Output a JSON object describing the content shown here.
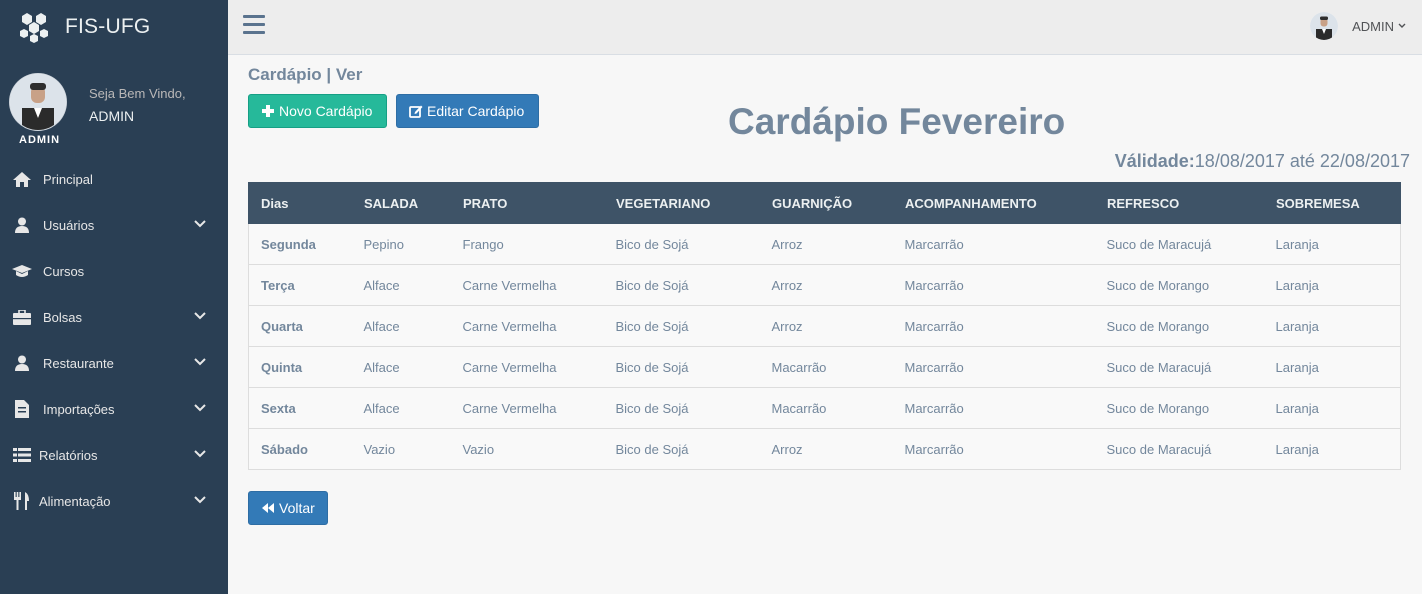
{
  "app": {
    "title": "FIS-UFG"
  },
  "sidebar": {
    "welcome": "Seja Bem Vindo,",
    "user_name": "ADMIN",
    "avatar_tag": "ADMIN",
    "items": [
      {
        "label": "Principal",
        "icon": "home-icon",
        "has_submenu": false
      },
      {
        "label": "Usuários",
        "icon": "user-icon",
        "has_submenu": true
      },
      {
        "label": "Cursos",
        "icon": "graduation-cap-icon",
        "has_submenu": false
      },
      {
        "label": "Bolsas",
        "icon": "briefcase-icon",
        "has_submenu": true
      },
      {
        "label": "Restaurante",
        "icon": "user-icon",
        "has_submenu": true
      },
      {
        "label": "Importações",
        "icon": "file-icon",
        "has_submenu": true
      },
      {
        "label": "Relatórios",
        "icon": "list-icon",
        "has_submenu": true
      },
      {
        "label": "Alimentação",
        "icon": "cutlery-icon",
        "has_submenu": true
      }
    ]
  },
  "topnav": {
    "user_label": "ADMIN"
  },
  "page": {
    "title": "Cardápio | Ver",
    "new_button": "Novo Cardápio",
    "edit_button": "Editar Cardápio",
    "heading": "Cardápio Fevereiro",
    "validity_label": "Válidade:",
    "validity_value": "18/08/2017 até 22/08/2017",
    "back_button": "Voltar"
  },
  "table": {
    "headers": [
      "Dias",
      "SALADA",
      "PRATO",
      "VEGETARIANO",
      "GUARNIÇÃO",
      "ACOMPANHAMENTO",
      "REFRESCO",
      "SOBREMESA"
    ],
    "rows": [
      [
        "Segunda",
        "Pepino",
        "Frango",
        "Bico de Sojá",
        "Arroz",
        "Marcarrão",
        "Suco de Maracujá",
        "Laranja"
      ],
      [
        "Terça",
        "Alface",
        "Carne Vermelha",
        "Bico de Sojá",
        "Arroz",
        "Marcarrão",
        "Suco de Morango",
        "Laranja"
      ],
      [
        "Quarta",
        "Alface",
        "Carne Vermelha",
        "Bico de Sojá",
        "Arroz",
        "Marcarrão",
        "Suco de Morango",
        "Laranja"
      ],
      [
        "Quinta",
        "Alface",
        "Carne Vermelha",
        "Bico de Sojá",
        "Macarrão",
        "Marcarrão",
        "Suco de Maracujá",
        "Laranja"
      ],
      [
        "Sexta",
        "Alface",
        "Carne Vermelha",
        "Bico de Sojá",
        "Macarrão",
        "Marcarrão",
        "Suco de Morango",
        "Laranja"
      ],
      [
        "Sábado",
        "Vazio",
        "Vazio",
        "Bico de Sojá",
        "Arroz",
        "Marcarrão",
        "Suco de Maracujá",
        "Laranja"
      ]
    ]
  },
  "colors": {
    "sidebar_bg": "#2A3F54",
    "table_header_bg": "#3E5367",
    "success": "#26B99A",
    "primary": "#337AB7",
    "text_muted": "#73879C"
  }
}
